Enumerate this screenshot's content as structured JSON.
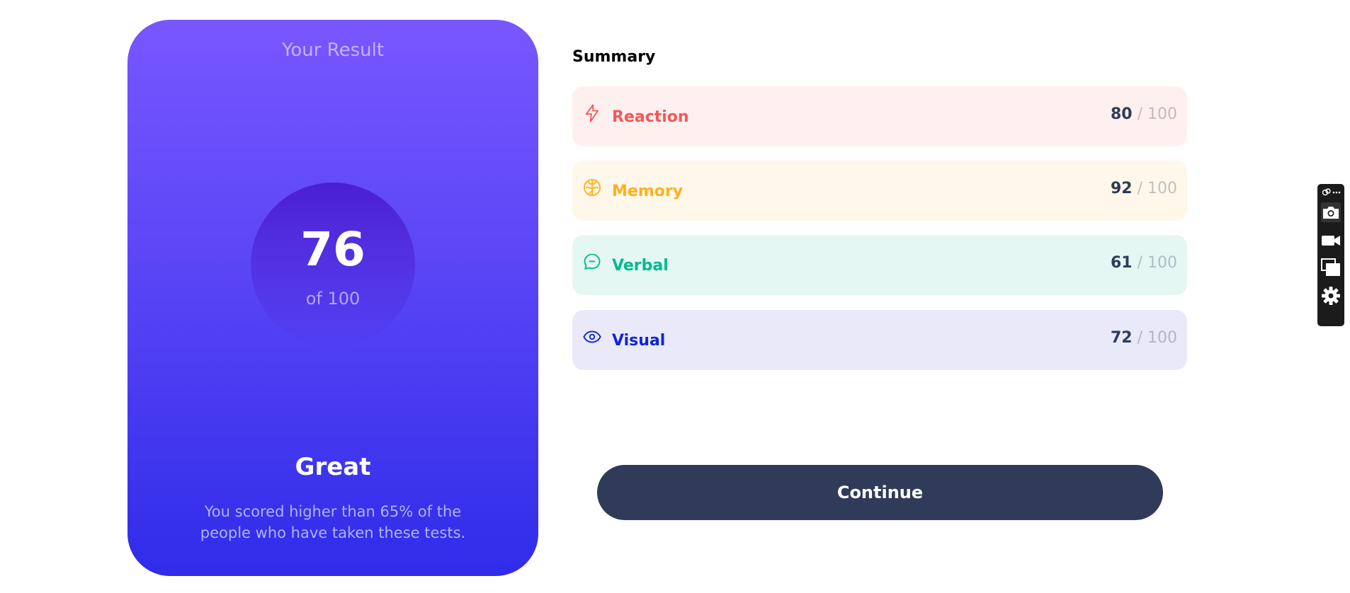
{
  "result": {
    "title": "Your Result",
    "score": "76",
    "score_total": "of 100",
    "rating": "Great",
    "description": "You scored higher than 65% of the people who have taken these tests."
  },
  "summary": {
    "title": "Summary",
    "items": [
      {
        "label": "Reaction",
        "score": "80",
        "max": "100",
        "icon": "lightning-icon",
        "color": "#f55757",
        "bg": "#fff0f0"
      },
      {
        "label": "Memory",
        "score": "92",
        "max": "100",
        "icon": "brain-icon",
        "color": "#ffb01e",
        "bg": "#fff8ea"
      },
      {
        "label": "Verbal",
        "score": "61",
        "max": "100",
        "icon": "speech-bubble-icon",
        "color": "#00bb8f",
        "bg": "#e5f7f3"
      },
      {
        "label": "Visual",
        "score": "72",
        "max": "100",
        "icon": "eye-icon",
        "color": "#1125d6",
        "bg": "#e9e9f9"
      }
    ],
    "separator": "/"
  },
  "continue_label": "Continue",
  "toolbar": {
    "items": [
      "screenshot-icon",
      "video-camera-icon",
      "windows-icon",
      "settings-gear-icon"
    ]
  }
}
